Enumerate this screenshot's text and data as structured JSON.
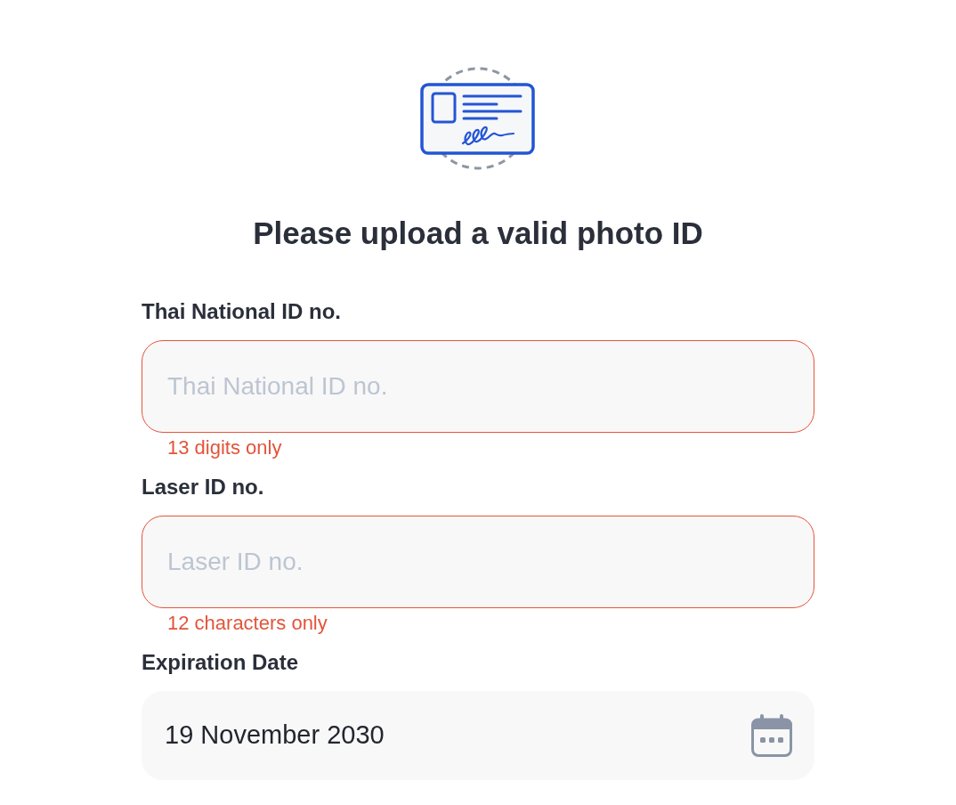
{
  "title": "Please upload a valid photo ID",
  "fields": [
    {
      "kind": "text",
      "label": "Thai National ID no.",
      "placeholder": "Thai National ID no.",
      "error": true,
      "error_message": "13 digits only"
    },
    {
      "kind": "text",
      "label": "Laser ID no.",
      "placeholder": "Laser ID no.",
      "error": true,
      "error_message": "12 characters only"
    },
    {
      "kind": "date",
      "label": "Expiration Date",
      "value": "19 November 2030",
      "error": false
    }
  ]
}
